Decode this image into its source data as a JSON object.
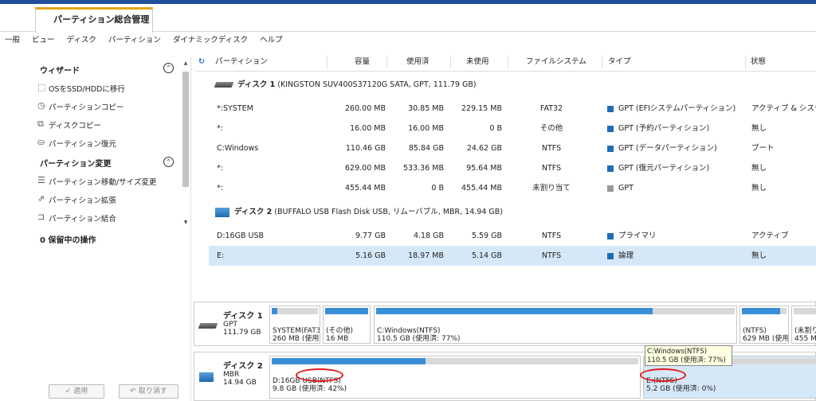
{
  "app": {
    "tab_title": "パーティション総合管理"
  },
  "menu": [
    "一般",
    "ビュー",
    "ディスク",
    "パーティション",
    "ダイナミックディスク",
    "ヘルプ"
  ],
  "sidebar": {
    "wizard_title": "ウィザード",
    "wizard_items": [
      {
        "label": "OSをSSD/HDDに移行",
        "icon": "migrate-icon"
      },
      {
        "label": "パーティションコピー",
        "icon": "copy-partition-icon"
      },
      {
        "label": "ディスクコピー",
        "icon": "copy-disk-icon"
      },
      {
        "label": "パーティション復元",
        "icon": "restore-icon"
      }
    ],
    "change_title": "パーティション変更",
    "change_items": [
      {
        "label": "パーティション移動/サイズ変更",
        "icon": "resize-icon"
      },
      {
        "label": "パーティション拡張",
        "icon": "extend-icon"
      },
      {
        "label": "パーティション結合",
        "icon": "merge-icon"
      }
    ],
    "pending": "0 保留中の操作",
    "apply_label": "✓ 適用",
    "undo_label": "↶ 取り消す"
  },
  "table": {
    "headers": [
      "パーティション",
      "容量",
      "使用済",
      "未使用",
      "ファイルシステム",
      "タイプ",
      "状態"
    ],
    "disk1": {
      "name": "ディスク 1",
      "desc": "(KINGSTON SUV400S37120G SATA, GPT, 111.79 GB)"
    },
    "disk2": {
      "name": "ディスク 2",
      "desc": "(BUFFALO USB Flash Disk USB, リムーバブル, MBR, 14.94 GB)"
    },
    "rows1": [
      {
        "p": "*:SYSTEM",
        "cap": "260.00 MB",
        "used": "30.85 MB",
        "free": "229.15 MB",
        "fs": "FAT32",
        "type": "GPT (EFIシステムパーティション)",
        "status": "アクティブ & システム",
        "type_color": "#1e6db8"
      },
      {
        "p": "*:",
        "cap": "16.00 MB",
        "used": "16.00 MB",
        "free": "0 B",
        "fs": "その他",
        "type": "GPT (予約パーティション)",
        "status": "無し",
        "type_color": "#1e6db8"
      },
      {
        "p": "C:Windows",
        "cap": "110.46 GB",
        "used": "85.84 GB",
        "free": "24.62 GB",
        "fs": "NTFS",
        "type": "GPT (データパーティション)",
        "status": "ブート",
        "type_color": "#1e6db8"
      },
      {
        "p": "*:",
        "cap": "629.00 MB",
        "used": "533.36 MB",
        "free": "95.64 MB",
        "fs": "NTFS",
        "type": "GPT (復元パーティション)",
        "status": "無し",
        "type_color": "#1e6db8"
      },
      {
        "p": "*:",
        "cap": "455.44 MB",
        "used": "0 B",
        "free": "455.44 MB",
        "fs": "未割り当て",
        "type": "GPT",
        "status": "無し",
        "type_color": "#999999"
      }
    ],
    "rows2": [
      {
        "p": "D:16GB USB",
        "cap": "9.77 GB",
        "used": "4.18 GB",
        "free": "5.59 GB",
        "fs": "NTFS",
        "type": "プライマリ",
        "status": "アクティブ",
        "type_color": "#1e6db8"
      },
      {
        "p": "E:",
        "cap": "5.16 GB",
        "used": "18.97 MB",
        "free": "5.14 GB",
        "fs": "NTFS",
        "type": "論理",
        "status": "無し",
        "type_color": "#1e6db8"
      }
    ]
  },
  "map": {
    "disk1": {
      "name": "ディスク 1",
      "scheme": "GPT",
      "size": "111.79 GB"
    },
    "disk2": {
      "name": "ディスク 2",
      "scheme": "MBR",
      "size": "14.94 GB"
    },
    "d1_blocks": [
      {
        "l1": "SYSTEM(FAT3",
        "l2": "260 MB (使用",
        "fill": 0.12
      },
      {
        "l1": "(その他)",
        "l2": "16 MB",
        "fill": 1.0
      },
      {
        "l1": "C:Windows(NTFS)",
        "l2": "110.5 GB (使用済: 77%)",
        "fill": 0.77
      },
      {
        "l1": "(NTFS)",
        "l2": "629 MB (使用",
        "fill": 0.85
      },
      {
        "l1": "(未割り",
        "l2": "455 M",
        "fill": 0.0
      }
    ],
    "d2_blocks": [
      {
        "l1": "D:16GB USB(NTFS)",
        "l2": "9.8 GB (使用済: 42%)",
        "fill": 0.42
      },
      {
        "l1": "E:(NTFS)",
        "l2": "5.2 GB (使用済: 0%)",
        "fill": 0.0
      }
    ],
    "tooltip": {
      "l1": "C:Windows(NTFS)",
      "l2": "110.5 GB (使用済: 77%)"
    }
  }
}
